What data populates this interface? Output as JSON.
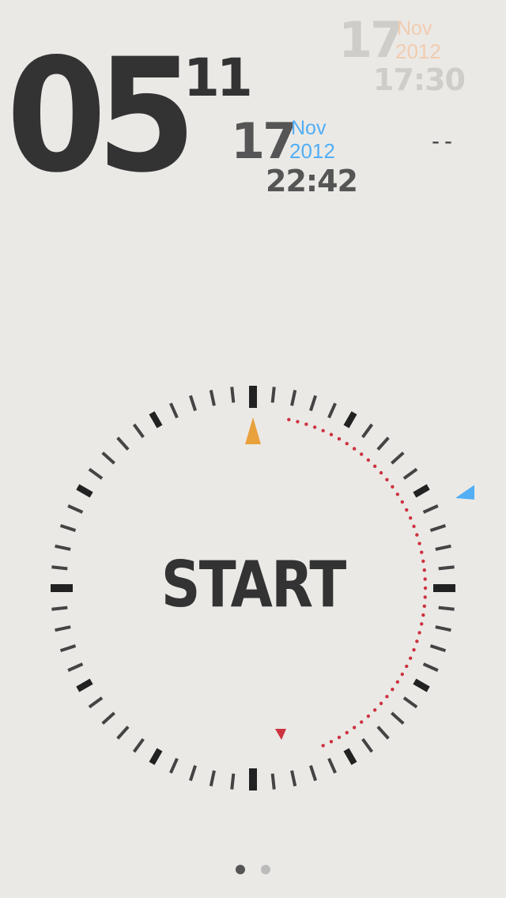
{
  "timer": {
    "main": "05",
    "sup": "11"
  },
  "previous_entry": {
    "day": "17",
    "month": "Nov",
    "year": "2012",
    "time": "17:30"
  },
  "current_entry": {
    "day": "17",
    "month": "Nov",
    "year": "2012",
    "time": "22:42"
  },
  "status_dashes": "--",
  "start_button": {
    "label": "START"
  },
  "dial": {
    "tick_count": 60,
    "red_arc_start_tick": 2,
    "red_arc_end_tick": 26
  },
  "pager": {
    "pages": 2,
    "active_index": 0
  },
  "colors": {
    "background": "#ebe9e6",
    "text_dark": "#333333",
    "accent_blue": "#52aef5",
    "accent_orange": "#e9a13c",
    "accent_red": "#cc3340",
    "faded_gray": "#cfcdca",
    "faded_orange": "#f1ccb0",
    "dot_active": "#555555",
    "dot_inactive": "#bbbbbb"
  }
}
